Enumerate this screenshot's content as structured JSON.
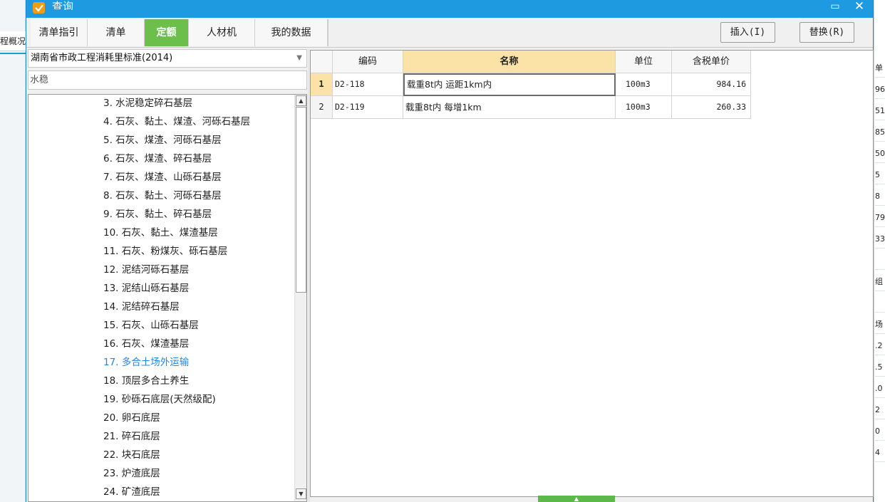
{
  "window": {
    "title": "查询",
    "maximize_icon": "maximize-icon",
    "close_icon": "close-icon"
  },
  "background": {
    "left_tab": "程概况",
    "right_column": [
      "单",
      "96",
      "51",
      "85",
      "50",
      "5",
      "8",
      "79",
      "33",
      "",
      "组",
      "",
      "场",
      ".2",
      ".5",
      ".0",
      "2",
      "0",
      "4"
    ]
  },
  "tabs": [
    {
      "label": "清单指引",
      "active": false
    },
    {
      "label": "清单",
      "active": false
    },
    {
      "label": "定额",
      "active": true
    },
    {
      "label": "人材机",
      "active": false
    },
    {
      "label": "我的数据",
      "active": false
    }
  ],
  "toolbar": {
    "insert_label": "插入(I)",
    "replace_label": "替换(R)"
  },
  "left": {
    "standard_select": "湖南省市政工程消耗里标准(2014)",
    "search_value": "水稳",
    "tree_items": [
      "3. 水泥稳定碎石基层",
      "4. 石灰、黏土、煤渣、河砾石基层",
      "5. 石灰、煤渣、河砾石基层",
      "6. 石灰、煤渣、碎石基层",
      "7. 石灰、煤渣、山砾石基层",
      "8. 石灰、黏土、河砾石基层",
      "9. 石灰、黏土、碎石基层",
      "10. 石灰、黏土、煤渣基层",
      "11. 石灰、粉煤灰、砾石基层",
      "12. 泥结河砾石基层",
      "13. 泥结山砾石基层",
      "14. 泥结碎石基层",
      "15. 石灰、山砾石基层",
      "16. 石灰、煤渣基层",
      "17. 多合土场外运输",
      "18. 顶层多合土养生",
      "19. 砂砾石底层(天然级配)",
      "20. 卵石底层",
      "21. 碎石底层",
      "22. 块石底层",
      "23. 炉渣底层",
      "24. 矿渣底层"
    ],
    "selected_index": 14
  },
  "grid": {
    "columns": [
      "编码",
      "名称",
      "单位",
      "含税单价"
    ],
    "rows": [
      {
        "index": "1",
        "code": "D2-118",
        "name": "载重8t内 运距1km内",
        "unit": "100m3",
        "price": "984.16"
      },
      {
        "index": "2",
        "code": "D2-119",
        "name": "载重8t内 每增1km",
        "unit": "100m3",
        "price": "260.33"
      }
    ]
  },
  "colors": {
    "titlebar": "#1e9ae0",
    "active_tab": "#6cbf4a",
    "header_highlight": "#fbe3a7",
    "selected_tree_text": "#1e88e5"
  }
}
